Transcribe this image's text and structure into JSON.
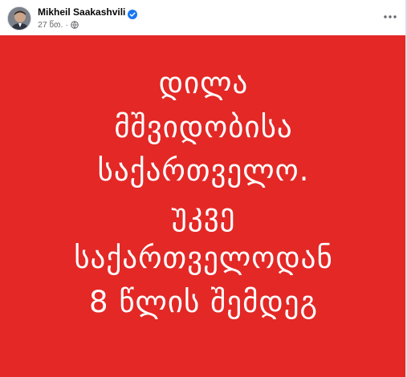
{
  "post": {
    "author_name": "Mikheil Saakashvili",
    "timestamp": "27 წთ.",
    "separator": "·",
    "privacy_icon": "globe-icon",
    "verified_icon": "verified-badge-icon",
    "more_icon": "more-horizontal-icon"
  },
  "image": {
    "background_color": "#e32826",
    "text_color": "#ffffff",
    "lines": [
      "დილა",
      "მშვიდობისა",
      "საქართველო.",
      "უკვე",
      "საქართველოდან",
      "8 წლის შემდეგ"
    ]
  },
  "colors": {
    "verified_blue": "#1877f2",
    "secondary_text": "#65676b"
  }
}
